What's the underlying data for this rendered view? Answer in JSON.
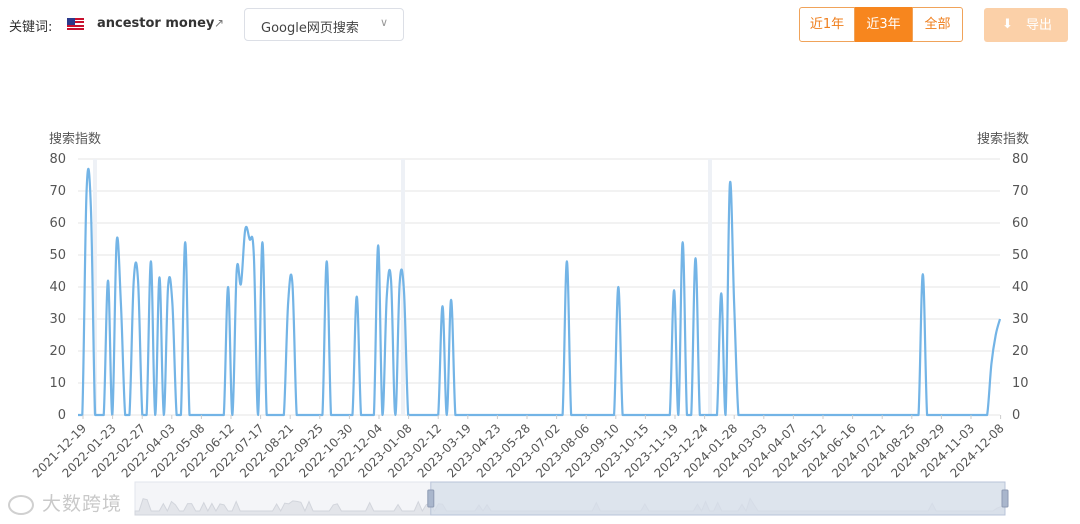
{
  "header": {
    "keyword_label": "关键词:",
    "keyword": "ancestor money",
    "country_icon": "us-flag-icon",
    "external_icon": "external-link-icon",
    "engine_select": {
      "value": "Google网页搜索",
      "icon": "chevron-down-icon"
    },
    "ranges": [
      {
        "label": "近1年",
        "active": false
      },
      {
        "label": "近3年",
        "active": true
      },
      {
        "label": "全部",
        "active": false
      }
    ],
    "export_label": "导出",
    "export_icon": "download-icon"
  },
  "colors": {
    "accent": "#f7861e",
    "line": "#73b4e6",
    "export_bg": "#fbd0a8",
    "zoom_window": "#d6deea"
  },
  "watermark": "大数跨境",
  "chart_data": {
    "type": "line",
    "ylabel_left": "搜索指数",
    "ylabel_right": "搜索指数",
    "ylim": [
      0,
      80
    ],
    "yticks": [
      0,
      10,
      20,
      30,
      40,
      50,
      60,
      70,
      80
    ],
    "grid": true,
    "x_tick_labels": [
      "2021-12-19",
      "2022-01-23",
      "2022-02-27",
      "2022-04-03",
      "2022-05-08",
      "2022-06-12",
      "2022-07-17",
      "2022-08-21",
      "2022-09-25",
      "2022-10-30",
      "2022-12-04",
      "2023-01-08",
      "2023-02-12",
      "2023-03-19",
      "2023-04-23",
      "2023-05-28",
      "2023-07-02",
      "2023-08-06",
      "2023-09-10",
      "2023-10-15",
      "2023-11-19",
      "2023-12-24",
      "2024-01-28",
      "2024-03-03",
      "2024-04-07",
      "2024-05-12",
      "2024-06-16",
      "2024-07-21",
      "2024-08-25",
      "2024-09-29",
      "2024-11-03",
      "2024-12-08"
    ],
    "series": [
      {
        "values": [
          0,
          0,
          70,
          65,
          0,
          0,
          0,
          42,
          0,
          54,
          35,
          0,
          0,
          42,
          42,
          0,
          0,
          48,
          0,
          43,
          0,
          40,
          35,
          0,
          0,
          54,
          0,
          0,
          0,
          0,
          0,
          0,
          0,
          0,
          0,
          40,
          0,
          45,
          41,
          58,
          55,
          50,
          0,
          54,
          0,
          0,
          0,
          0,
          0,
          35,
          41,
          0,
          0,
          0,
          0,
          0,
          0,
          0,
          48,
          0,
          0,
          0,
          0,
          0,
          0,
          37,
          0,
          0,
          0,
          0,
          53,
          0,
          37,
          42,
          0,
          41,
          39,
          0,
          0,
          0,
          0,
          0,
          0,
          0,
          0,
          34,
          0,
          36,
          0,
          0,
          0,
          0,
          0,
          0,
          0,
          0,
          0,
          0,
          0,
          0,
          0,
          0,
          0,
          0,
          0,
          0,
          0,
          0,
          0,
          0,
          0,
          0,
          0,
          0,
          48,
          0,
          0,
          0,
          0,
          0,
          0,
          0,
          0,
          0,
          0,
          0,
          40,
          0,
          0,
          0,
          0,
          0,
          0,
          0,
          0,
          0,
          0,
          0,
          0,
          39,
          0,
          54,
          0,
          0,
          49,
          0,
          0,
          0,
          0,
          0,
          38,
          0,
          72,
          35,
          0,
          0,
          0,
          0,
          0,
          0,
          0,
          0,
          0,
          0,
          0,
          0,
          0,
          0,
          0,
          0,
          0,
          0,
          0,
          0,
          0,
          0,
          0,
          0,
          0,
          0,
          0,
          0,
          0,
          0,
          0,
          0,
          0,
          0,
          0,
          0,
          0,
          0,
          0,
          0,
          0,
          0,
          0,
          44,
          0,
          0,
          0,
          0,
          0,
          0,
          0,
          0,
          0,
          0,
          0,
          0,
          0,
          0,
          0,
          16,
          25,
          30
        ]
      }
    ],
    "zoom_slider": {
      "start_fraction": 0.34,
      "end_fraction": 1.0
    }
  }
}
